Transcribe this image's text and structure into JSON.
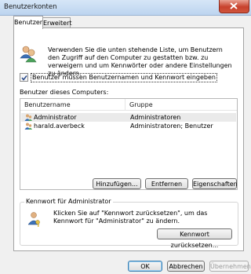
{
  "window": {
    "title": "Benutzerkonten"
  },
  "tabs": [
    {
      "label": "Benutzer"
    },
    {
      "label": "Erweitert"
    }
  ],
  "intro_text": "Verwenden Sie die unten stehende Liste, um Benutzern den Zugriff auf den Computer zu gestatten bzw. zu verweigern und um Kennwörter oder andere Einstellungen zu ändern.",
  "checkbox": {
    "label": "Benutzer müssen Benutzernamen und Kennwort eingeben",
    "checked": true
  },
  "users_label": "Benutzer dieses Computers:",
  "list": {
    "columns": [
      "Benutzername",
      "Gruppe"
    ],
    "rows": [
      {
        "name": "Administrator",
        "group": "Administratoren"
      },
      {
        "name": "harald.averbeck",
        "group": "Administratoren; Benutzer"
      }
    ]
  },
  "buttons": {
    "add": "Hinzufügen...",
    "remove": "Entfernen",
    "properties": "Eigenschaften"
  },
  "password_section": {
    "title": "Kennwort für Administrator",
    "text": "Klicken Sie auf \"Kennwort zurücksetzen\", um das Kennwort für \"Administrator\" zu ändern.",
    "reset_button": "Kennwort zurücksetzen..."
  },
  "footer": {
    "ok": "OK",
    "cancel": "Abbrechen",
    "apply": "Übernehmen"
  },
  "colors": {
    "titlebar": "#c6daf1",
    "close": "#c8412c",
    "selection": "#eaeaea"
  },
  "icons": {
    "users": "users-icon",
    "key": "user-key-icon",
    "close": "close-icon"
  }
}
